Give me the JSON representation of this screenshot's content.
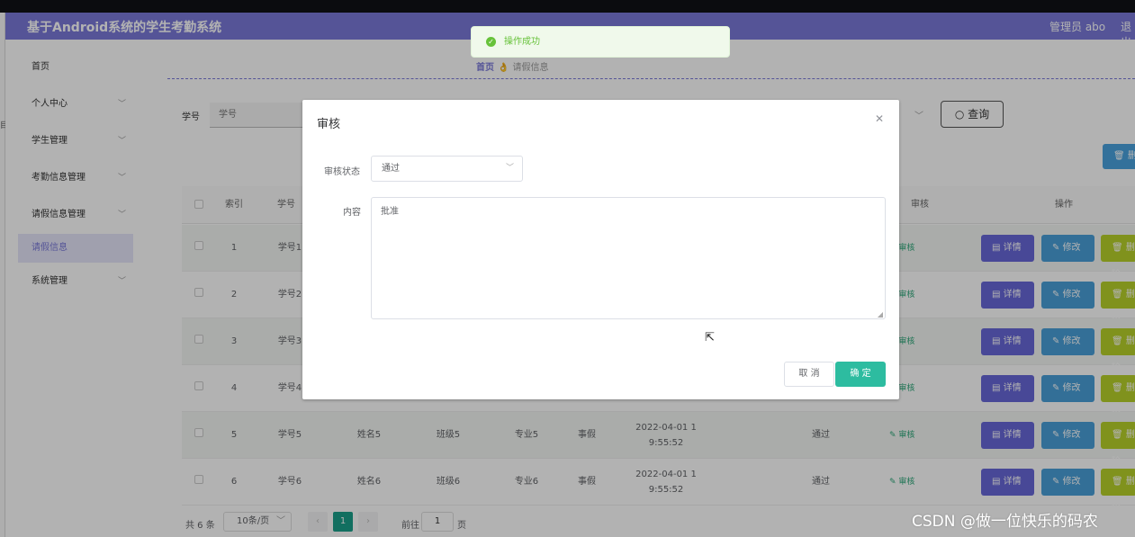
{
  "header": {
    "title": "基于Android系统的学生考勤系统",
    "admin": "管理员 abo",
    "logout": "退出"
  },
  "sidebar": {
    "items": [
      {
        "label": "首页"
      },
      {
        "label": "个人中心"
      },
      {
        "label": "学生管理"
      },
      {
        "label": "考勤信息管理"
      },
      {
        "label": "请假信息管理"
      },
      {
        "label": "请假信息"
      },
      {
        "label": "系统管理"
      }
    ]
  },
  "breadcrumb": {
    "home": "首页",
    "separator": "👌",
    "current": "请假信息"
  },
  "search": {
    "label": "学号",
    "placeholder": "学号",
    "query_label": "查询"
  },
  "toolbar": {
    "delete_label": "删除"
  },
  "table": {
    "headers": {
      "index": "索引",
      "student_no": "学号",
      "audit": "审核",
      "actions": "操作"
    },
    "audit_link": "审核",
    "btn_detail": "详情",
    "btn_edit": "修改",
    "btn_delete": "删除",
    "rows": [
      {
        "index": "1",
        "student_no": "学号1"
      },
      {
        "index": "2",
        "student_no": "学号2"
      },
      {
        "index": "3",
        "student_no": "学号3"
      },
      {
        "index": "4",
        "student_no": "学号4"
      },
      {
        "index": "5",
        "student_no": "学号5",
        "name": "姓名5",
        "class": "班级5",
        "major": "专业5",
        "type": "事假",
        "time_line1": "2022-04-01 1",
        "time_line2": "9:55:52",
        "status": "通过"
      },
      {
        "index": "6",
        "student_no": "学号6",
        "name": "姓名6",
        "class": "班级6",
        "major": "专业6",
        "type": "事假",
        "time_line1": "2022-04-01 1",
        "time_line2": "9:55:52",
        "status": "通过"
      }
    ]
  },
  "pagination": {
    "total": "共 6 条",
    "page_size": "10条/页",
    "current_page": "1",
    "goto_label": "前往",
    "goto_value": "1",
    "page_suffix": "页"
  },
  "toast": {
    "message": "操作成功"
  },
  "dialog": {
    "title": "审核",
    "status_label": "审核状态",
    "status_value": "通过",
    "content_label": "内容",
    "content_value": "批准",
    "cancel_label": "取 消",
    "confirm_label": "确 定"
  },
  "watermark": "CSDN @做一位快乐的码农",
  "colors": {
    "primary": "#7a79d9",
    "confirm": "#2dbca0",
    "success": "#67c23a"
  }
}
